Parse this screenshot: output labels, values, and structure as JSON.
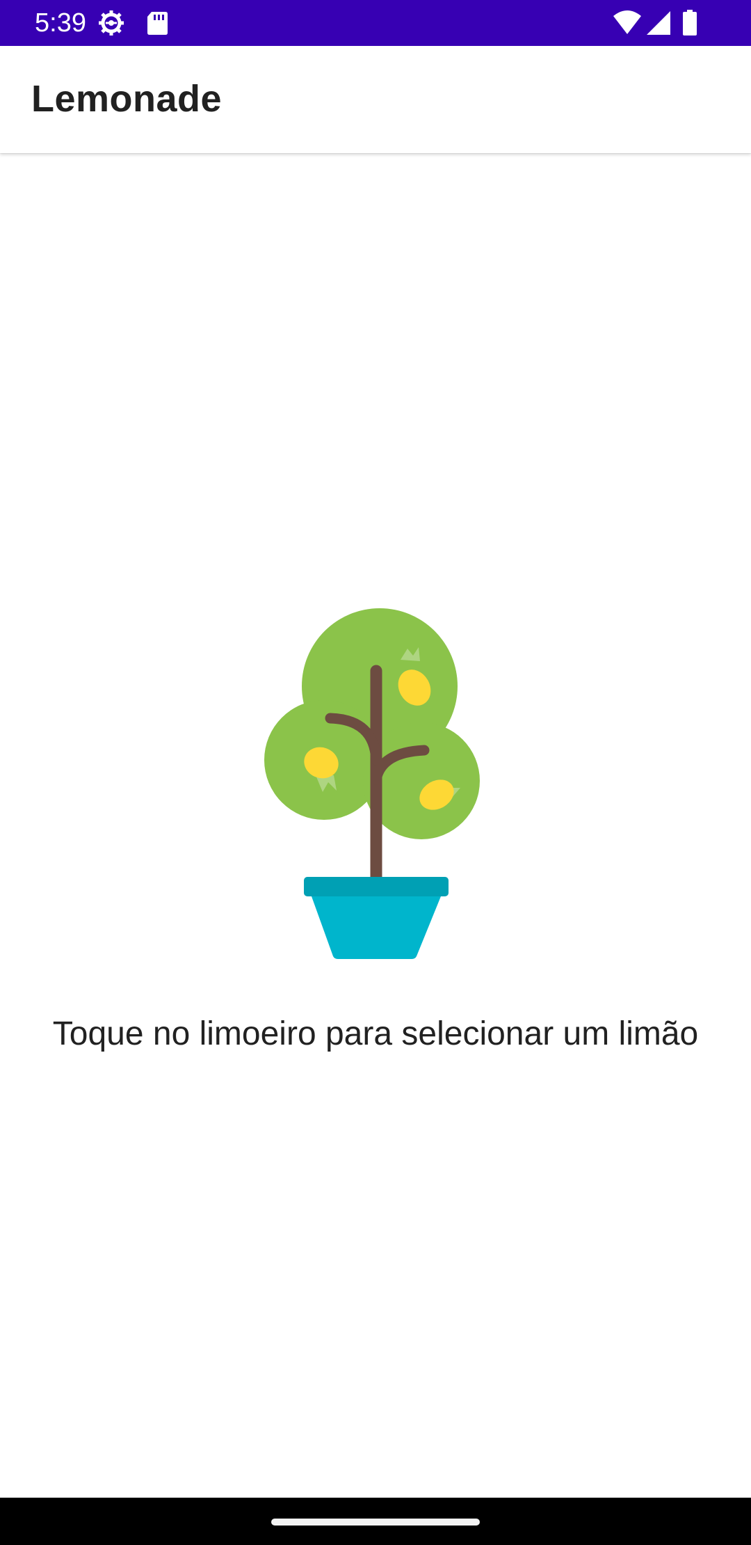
{
  "status_bar": {
    "time": "5:39",
    "background": "#3700b3",
    "left_icons": [
      "settings-gear-icon",
      "sd-card-icon"
    ],
    "right_icons": [
      "wifi-icon",
      "cell-signal-icon",
      "battery-icon"
    ]
  },
  "app_bar": {
    "title": "Lemonade"
  },
  "main": {
    "image": "lemon-tree",
    "instruction": "Toque no limoeiro para selecionar um limão"
  },
  "colors": {
    "foliage": "#8bc34a",
    "trunk": "#6d4c41",
    "lemon": "#fdd835",
    "pot": "#00b5cc",
    "pot_rim": "#00a0b4"
  }
}
